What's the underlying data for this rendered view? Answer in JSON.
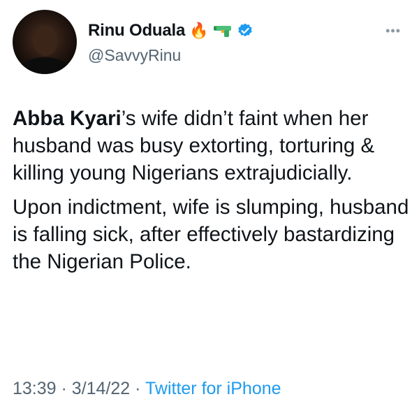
{
  "user": {
    "display_name": "Rinu Oduala",
    "handle": "@SavvyRinu",
    "name_emojis": [
      "fire-emoji",
      "water-pistol-emoji"
    ],
    "verified": true,
    "verified_color": "#1d9bf0"
  },
  "tweet": {
    "paragraph1_bold": "Abba Kyari",
    "paragraph1_rest": "’s wife didn’t faint when her husband was busy extorting, torturing & killing young Nigerians extrajudicially.",
    "paragraph2": "Upon indictment, wife is slumping, husband is falling sick, after effectively bastardizing the Nigerian Police."
  },
  "meta": {
    "time": "13:39",
    "date": "3/14/22",
    "separator": "·",
    "source": "Twitter for iPhone",
    "source_color": "#1d9bf0"
  },
  "more_menu_icon": "more-dots-icon"
}
